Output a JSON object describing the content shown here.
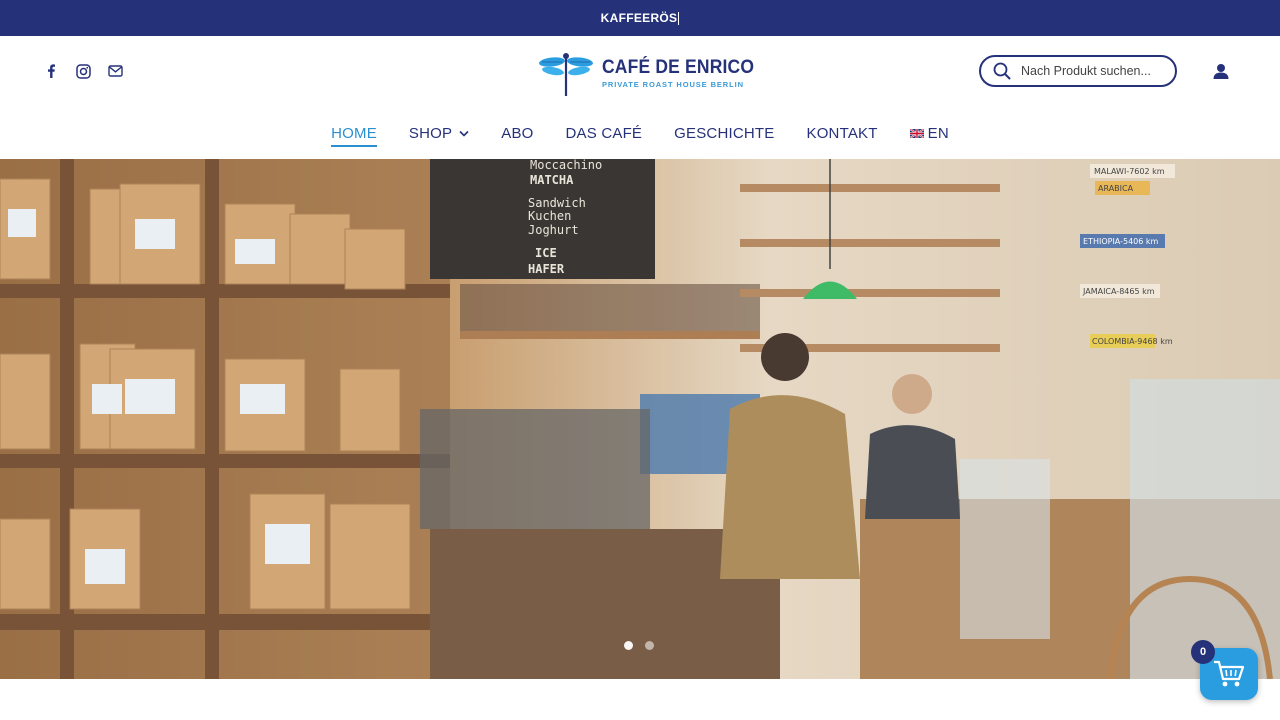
{
  "announcement": {
    "text": "KAFFEERÖS"
  },
  "brand": {
    "name": "CAFÉ DE ENRICO",
    "tagline": "PRIVATE ROAST HOUSE BERLIN",
    "logo_icon": "dragonfly-icon"
  },
  "social": [
    {
      "icon": "facebook-icon"
    },
    {
      "icon": "instagram-icon"
    },
    {
      "icon": "mail-icon"
    }
  ],
  "search": {
    "placeholder": "Nach Produkt suchen..."
  },
  "nav": {
    "items": [
      {
        "label": "HOME",
        "active": true
      },
      {
        "label": "SHOP",
        "dropdown": true
      },
      {
        "label": "ABO"
      },
      {
        "label": "DAS CAFÉ"
      },
      {
        "label": "GESCHICHTE"
      },
      {
        "label": "KONTAKT"
      },
      {
        "label": "EN",
        "icon": "uk-flag-icon"
      }
    ]
  },
  "hero": {
    "slides": 2,
    "active_slide": 1,
    "menu_board": [
      "Moccachino",
      "MATCHA",
      "Sandwich",
      "Kuchen",
      "Joghurt",
      "ICE",
      "HAFER"
    ],
    "signs": [
      "MALAWI-7602 km",
      "ARABICA",
      "ETHIOPIA-5406 km",
      "JAMAICA-8465 km",
      "COLOMBIA-9468 km"
    ]
  },
  "cart": {
    "count": "0"
  },
  "colors": {
    "primary": "#25327a",
    "accent": "#2a8fd1",
    "cart": "#2a9de0"
  }
}
